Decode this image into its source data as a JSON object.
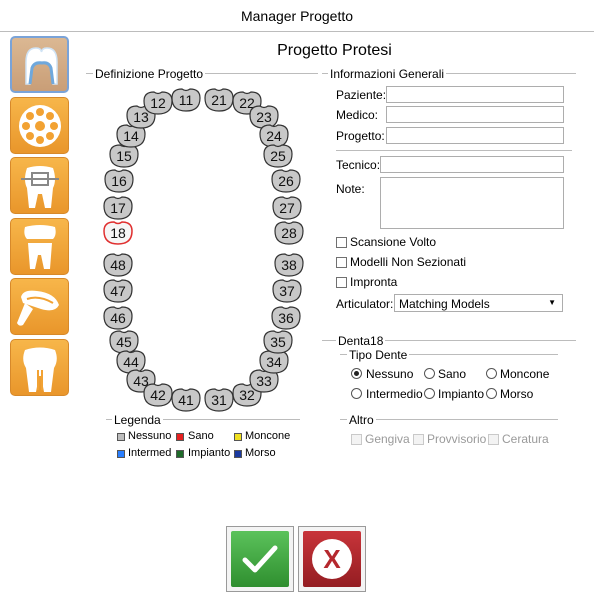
{
  "window_title": "Manager Progetto",
  "page_title": "Progetto Protesi",
  "sidebar": {
    "items": [
      {
        "name": "prosthesis-tooth",
        "active": true
      },
      {
        "name": "implant-wheel",
        "active": false
      },
      {
        "name": "orthodontic-bracket",
        "active": false
      },
      {
        "name": "tooth-crown",
        "active": false
      },
      {
        "name": "impression-tray",
        "active": false
      },
      {
        "name": "tooth-root",
        "active": false
      }
    ]
  },
  "definizione": {
    "label": "Definizione Progetto",
    "upper_teeth": [
      "18",
      "17",
      "16",
      "15",
      "14",
      "13",
      "12",
      "11",
      "21",
      "22",
      "23",
      "24",
      "25",
      "26",
      "27",
      "28"
    ],
    "lower_teeth": [
      "48",
      "47",
      "46",
      "45",
      "44",
      "43",
      "42",
      "41",
      "31",
      "32",
      "33",
      "34",
      "35",
      "36",
      "37",
      "38"
    ],
    "selected_tooth": "18",
    "tooth_fill": "#c8c8c8",
    "selected_outline": "#e03030"
  },
  "legenda": {
    "label": "Legenda",
    "items": [
      {
        "label": "Nessuno",
        "color": "#bdbdbd"
      },
      {
        "label": "Sano",
        "color": "#e62020"
      },
      {
        "label": "Moncone",
        "color": "#f0e020"
      },
      {
        "label": "Intermed",
        "color": "#2a7fff"
      },
      {
        "label": "Impianto",
        "color": "#1f6b2a"
      },
      {
        "label": "Morso",
        "color": "#1a3aa0"
      }
    ]
  },
  "info": {
    "label": "Informazioni Generali",
    "paziente_label": "Paziente:",
    "paziente_value": "",
    "medico_label": "Medico:",
    "medico_value": "",
    "progetto_label": "Progetto:",
    "progetto_value": "",
    "tecnico_label": "Tecnico:",
    "tecnico_value": "",
    "note_label": "Note:",
    "note_value": "",
    "scansione_label": "Scansione Volto",
    "modelli_label": "Modelli Non Sezionati",
    "impronta_label": "Impronta",
    "articulator_label": "Articulator:",
    "articulator_value": "Matching Models"
  },
  "dente": {
    "label": "Denta18",
    "tipo_label": "Tipo Dente",
    "options": [
      "Nessuno",
      "Sano",
      "Moncone",
      "Intermedio",
      "Impianto",
      "Morso"
    ],
    "selected": "Nessuno",
    "altro_label": "Altro",
    "altro_options": [
      "Gengiva",
      "Provvisorio",
      "Ceratura"
    ]
  },
  "buttons": {
    "ok_color": "#3aa53a",
    "cancel_color": "#b5282e",
    "cancel_glyph": "X"
  }
}
